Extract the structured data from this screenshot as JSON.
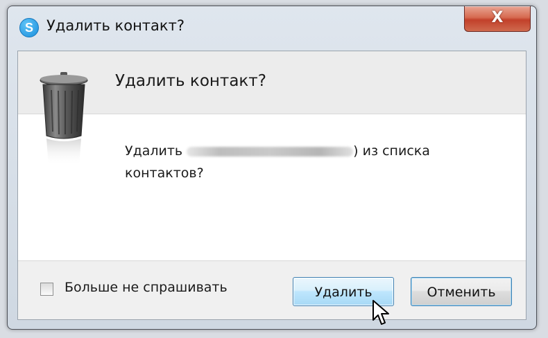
{
  "window": {
    "title": "Удалить контакт?",
    "app_icon": "skype-icon",
    "close_label": "X"
  },
  "dialog": {
    "header_title": "Удалить контакт?",
    "header_icon": "trash-icon",
    "message_before": "Удалить",
    "message_after": ") из списка",
    "message_line2": "контактов?"
  },
  "footer": {
    "checkbox_label": "Больше не спрашивать",
    "checkbox_checked": false,
    "delete_label": "Удалить",
    "cancel_label": "Отменить"
  },
  "colors": {
    "close_button": "#c2402a",
    "focused_button_border": "#3c7fb1"
  }
}
